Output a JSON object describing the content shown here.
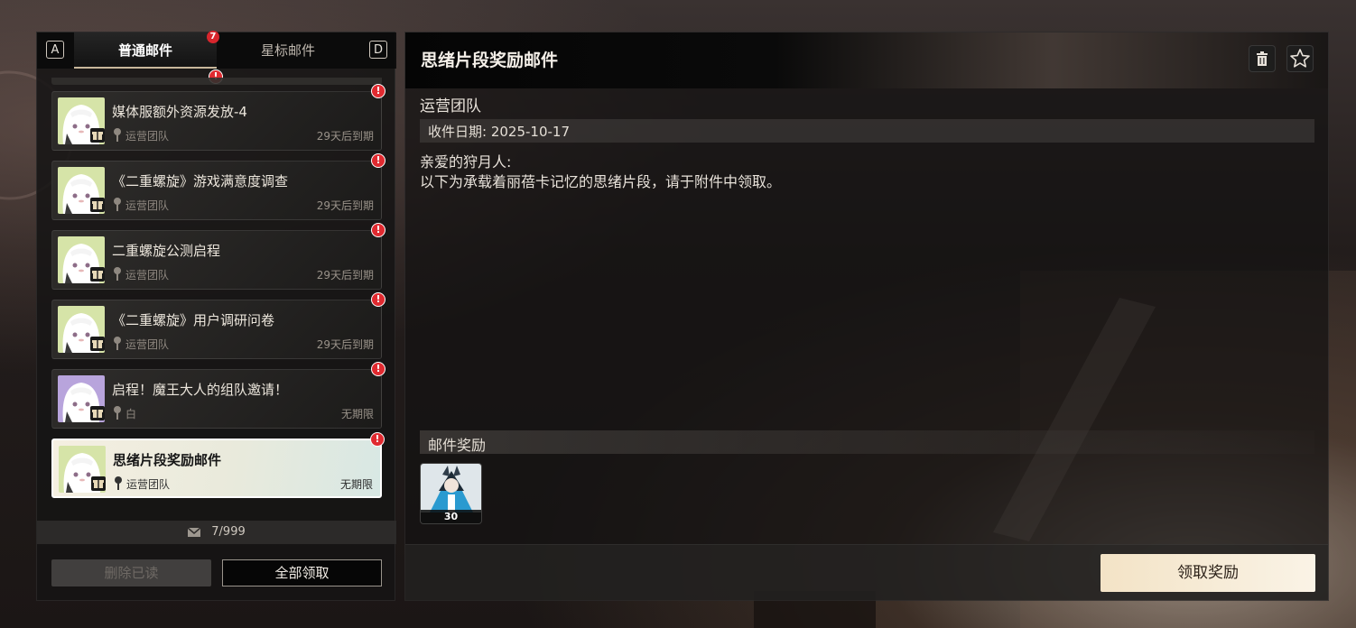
{
  "tabs": {
    "left_key": "A",
    "right_key": "D",
    "normal": "普通邮件",
    "normal_count": "7",
    "starred": "星标邮件"
  },
  "alert_glyph": "!",
  "mails": [
    {
      "title": "媒体服额外资源发放-4",
      "sender": "运营团队",
      "expiry": "29天后到期",
      "avatar": "white",
      "unread": true,
      "selected": false
    },
    {
      "title": "《二重螺旋》游戏满意度调查",
      "sender": "运营团队",
      "expiry": "29天后到期",
      "avatar": "white",
      "unread": true,
      "selected": false
    },
    {
      "title": "二重螺旋公测启程",
      "sender": "运营团队",
      "expiry": "29天后到期",
      "avatar": "white",
      "unread": true,
      "selected": false
    },
    {
      "title": "《二重螺旋》用户调研问卷",
      "sender": "运营团队",
      "expiry": "29天后到期",
      "avatar": "white",
      "unread": true,
      "selected": false
    },
    {
      "title": "启程！魔王大人的组队邀请！",
      "sender": "白",
      "expiry": "无期限",
      "avatar": "purple",
      "unread": true,
      "selected": false
    },
    {
      "title": "思绪片段奖励邮件",
      "sender": "运营团队",
      "expiry": "无期限",
      "avatar": "white",
      "unread": true,
      "selected": true
    }
  ],
  "mail_counter": "7/999",
  "buttons": {
    "delete_read": "删除已读",
    "claim_all": "全部领取",
    "claim_reward": "领取奖励"
  },
  "detail": {
    "title": "思绪片段奖励邮件",
    "sender": "运营团队",
    "date_label": "收件日期: 2025-10-17",
    "body_line1": "亲爱的狩月人:",
    "body_line2": "以下为承载着丽蓓卡记忆的思绪片段，请于附件中领取。",
    "rewards_label": "邮件奖励",
    "reward_qty": "30"
  },
  "icons": {
    "delete": "trash-icon",
    "star": "star-icon",
    "mail": "envelope-icon",
    "gift": "gift-icon",
    "pin": "pin-icon"
  },
  "colors": {
    "alert": "#e02a30",
    "claim_button": "#f3e3c6",
    "avatar_white_bg": "#d6e4a8",
    "avatar_purple_bg": "#b8a4dc"
  }
}
